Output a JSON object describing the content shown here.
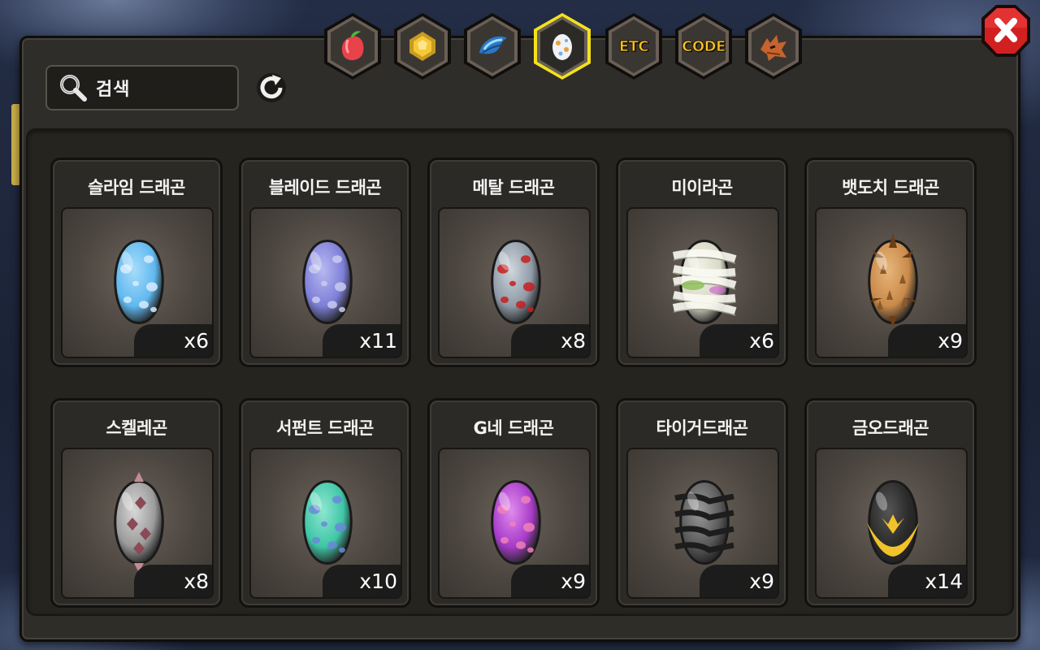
{
  "search": {
    "label": "검색",
    "icon": "search-icon"
  },
  "toolbar": {
    "refresh_icon": "refresh-icon",
    "close_icon": "close-icon"
  },
  "tabs": [
    {
      "id": "fruit",
      "icon": "fruit-icon",
      "label": "",
      "selected": false
    },
    {
      "id": "gold",
      "icon": "gold-coin-icon",
      "label": "",
      "selected": false
    },
    {
      "id": "scale",
      "icon": "blue-scale-icon",
      "label": "",
      "selected": false
    },
    {
      "id": "egg",
      "icon": "egg-icon",
      "label": "",
      "selected": true
    },
    {
      "id": "etc",
      "icon": "",
      "label": "ETC",
      "selected": false
    },
    {
      "id": "code",
      "icon": "",
      "label": "CODE",
      "selected": false
    },
    {
      "id": "dragon",
      "icon": "dragon-head-icon",
      "label": "",
      "selected": false
    }
  ],
  "items": [
    {
      "name": "슬라임 드래곤",
      "count": "x6",
      "egg": {
        "base": "#5fb8ef",
        "light": "#a6dcfb",
        "spot": "#d7ecff",
        "style": "spots"
      }
    },
    {
      "name": "블레이드 드래곤",
      "count": "x11",
      "egg": {
        "base": "#7d7fd8",
        "light": "#b7b8f0",
        "spot": "#c9cbef",
        "style": "spots"
      }
    },
    {
      "name": "메탈 드래곤",
      "count": "x8",
      "egg": {
        "base": "#8e9aa6",
        "light": "#cfd6dc",
        "spot": "#c71d1d",
        "style": "spots"
      }
    },
    {
      "name": "미이라곤",
      "count": "x6",
      "egg": {
        "base": "#d9d9c8",
        "light": "#f1f1e6",
        "spot": "#8fbf5a",
        "style": "bandage"
      }
    },
    {
      "name": "뱃도치 드래곤",
      "count": "x9",
      "egg": {
        "base": "#c98a4a",
        "light": "#e7b57a",
        "spot": "#8a5a2a",
        "style": "spiky"
      }
    },
    {
      "name": "스켈레곤",
      "count": "x8",
      "egg": {
        "base": "#9b9b9b",
        "light": "#d7d7d7",
        "spot": "#8a4a55",
        "style": "skull"
      }
    },
    {
      "name": "서펀트 드래곤",
      "count": "x10",
      "egg": {
        "base": "#3fc6a6",
        "light": "#8ee6d0",
        "spot": "#6a88d8",
        "style": "spots"
      }
    },
    {
      "name": "G네 드래곤",
      "count": "x9",
      "egg": {
        "base": "#a73bc8",
        "light": "#e08bee",
        "spot": "#ee80b8",
        "style": "spots"
      }
    },
    {
      "name": "타이거드래곤",
      "count": "x9",
      "egg": {
        "base": "#5a5a5a",
        "light": "#9a9a9a",
        "spot": "#1d1d1d",
        "style": "stripes"
      }
    },
    {
      "name": "금오드래곤",
      "count": "x14",
      "egg": {
        "base": "#2a2a2a",
        "light": "#555",
        "spot": "#f2c22a",
        "style": "gold"
      }
    }
  ]
}
